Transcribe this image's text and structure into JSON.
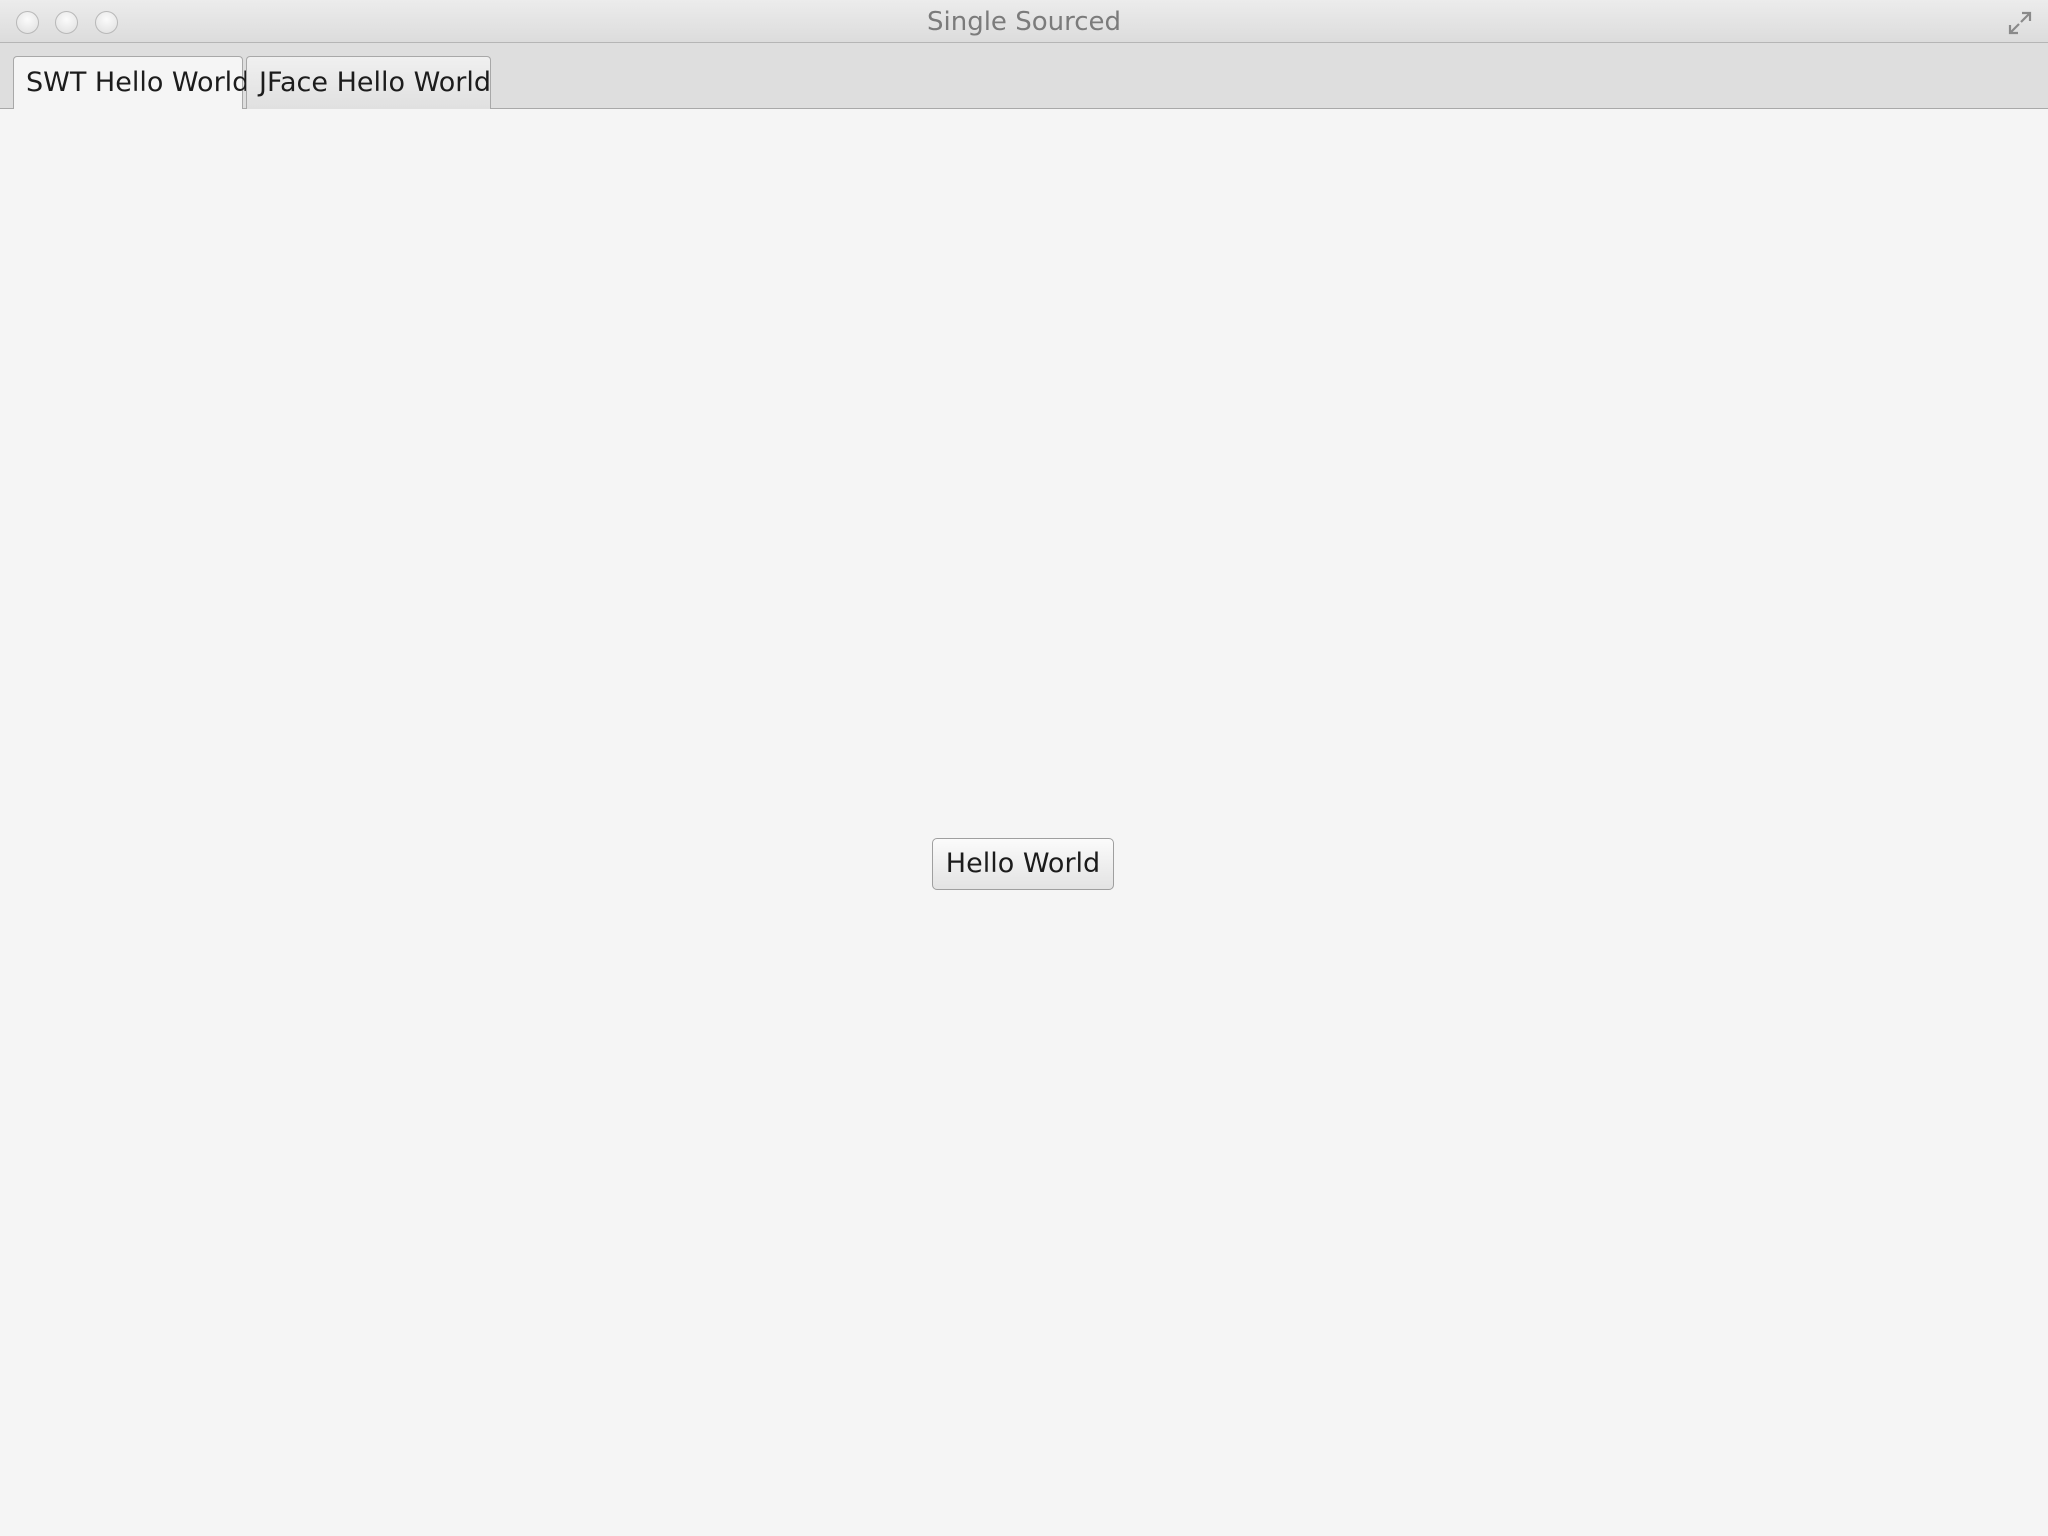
{
  "window": {
    "title": "Single Sourced"
  },
  "tabs": [
    {
      "label": "SWT Hello World",
      "selected": true
    },
    {
      "label": "JFace Hello World",
      "selected": false
    }
  ],
  "content": {
    "button_label": "Hello World"
  },
  "colors": {
    "background": "#f5f5f5",
    "tabbar": "#dedede",
    "title_text": "#7b7b7b"
  }
}
